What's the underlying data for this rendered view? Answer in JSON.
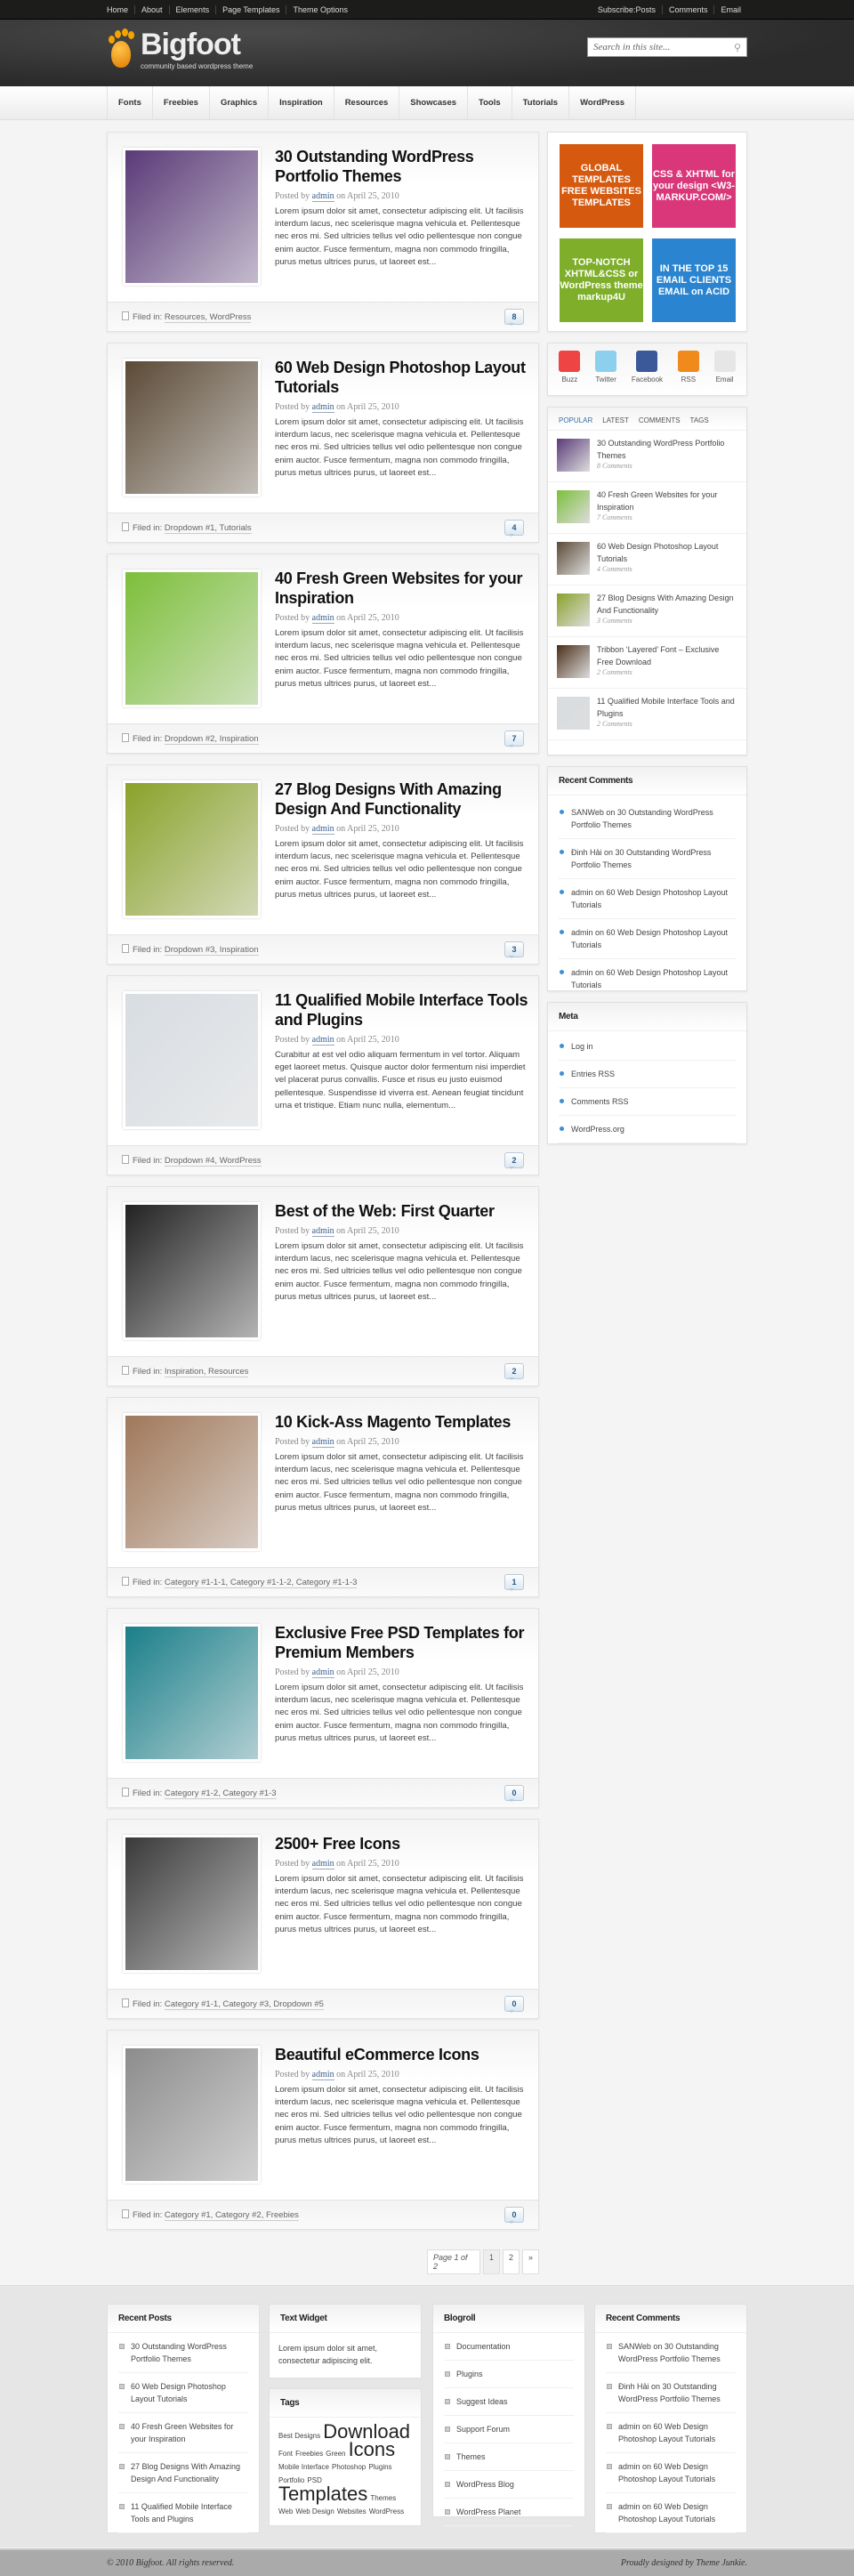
{
  "topbar": {
    "links": [
      "Home",
      "About",
      "Elements",
      "Page Templates",
      "Theme Options"
    ],
    "subscribe_label": "Subscribe:",
    "subscribe": [
      "Posts",
      "Comments",
      "Email"
    ]
  },
  "header": {
    "title": "Bigfoot",
    "tagline": "community based wordpress theme",
    "search_placeholder": "Search in this site..."
  },
  "nav": [
    "Fonts",
    "Freebies",
    "Graphics",
    "Inspiration",
    "Resources",
    "Showcases",
    "Tools",
    "Tutorials",
    "WordPress"
  ],
  "posted_by": "Posted by",
  "author": "admin",
  "date_prefix": "on",
  "filed_label": "Filed in:",
  "posts": [
    {
      "title": "30 Outstanding WordPress Portfolio Themes",
      "date": "April 25, 2010",
      "excerpt": "Lorem ipsum dolor sit amet, consectetur adipiscing elit. Ut facilisis interdum lacus, nec scelerisque magna vehicula et. Pellentesque nec eros mi. Sed ultricies tellus vel odio pellentesque non congue enim auctor. Fusce fermentum, magna non commodo fringilla, purus metus ultrices purus, ut laoreet est...",
      "categories": "Resources, WordPress",
      "comments": "8",
      "thumb": "#5a3a78"
    },
    {
      "title": "60 Web Design Photoshop Layout Tutorials",
      "date": "April 25, 2010",
      "excerpt": "Lorem ipsum dolor sit amet, consectetur adipiscing elit. Ut facilisis interdum lacus, nec scelerisque magna vehicula et. Pellentesque nec eros mi. Sed ultricies tellus vel odio pellentesque non congue enim auctor. Fusce fermentum, magna non commodo fringilla, purus metus ultrices purus, ut laoreet est...",
      "categories": "Dropdown #1, Tutorials",
      "comments": "4",
      "thumb": "#5b4a36"
    },
    {
      "title": "40 Fresh Green Websites for your Inspiration",
      "date": "April 25, 2010",
      "excerpt": "Lorem ipsum dolor sit amet, consectetur adipiscing elit. Ut facilisis interdum lacus, nec scelerisque magna vehicula et. Pellentesque nec eros mi. Sed ultricies tellus vel odio pellentesque non congue enim auctor. Fusce fermentum, magna non commodo fringilla, purus metus ultrices purus, ut laoreet est...",
      "categories": "Dropdown #2, Inspiration",
      "comments": "7",
      "thumb": "#7cbf3a"
    },
    {
      "title": "27 Blog Designs With Amazing Design And Functionality",
      "date": "April 25, 2010",
      "excerpt": "Lorem ipsum dolor sit amet, consectetur adipiscing elit. Ut facilisis interdum lacus, nec scelerisque magna vehicula et. Pellentesque nec eros mi. Sed ultricies tellus vel odio pellentesque non congue enim auctor. Fusce fermentum, magna non commodo fringilla, purus metus ultrices purus, ut laoreet est...",
      "categories": "Dropdown #3, Inspiration",
      "comments": "3",
      "thumb": "#8aa22a"
    },
    {
      "title": "11 Qualified Mobile Interface Tools and Plugins",
      "date": "April 25, 2010",
      "excerpt": "Curabitur at est vel odio aliquam fermentum in vel tortor. Aliquam eget laoreet metus. Quisque auctor dolor fermentum nisi imperdiet vel placerat purus convallis. Fusce et risus eu justo euismod pellentesque. Suspendisse id viverra est. Aenean feugiat tincidunt urna et tristique. Etiam nunc nulla, elementum...",
      "categories": "Dropdown #4, WordPress",
      "comments": "2",
      "thumb": "#d8dde2"
    },
    {
      "title": "Best of the Web: First Quarter",
      "date": "April 25, 2010",
      "excerpt": "Lorem ipsum dolor sit amet, consectetur adipiscing elit. Ut facilisis interdum lacus, nec scelerisque magna vehicula et. Pellentesque nec eros mi. Sed ultricies tellus vel odio pellentesque non congue enim auctor. Fusce fermentum, magna non commodo fringilla, purus metus ultrices purus, ut laoreet est...",
      "categories": "Inspiration, Resources",
      "comments": "2",
      "thumb": "#222"
    },
    {
      "title": "10 Kick-Ass Magento Templates",
      "date": "April 25, 2010",
      "excerpt": "Lorem ipsum dolor sit amet, consectetur adipiscing elit. Ut facilisis interdum lacus, nec scelerisque magna vehicula et. Pellentesque nec eros mi. Sed ultricies tellus vel odio pellentesque non congue enim auctor. Fusce fermentum, magna non commodo fringilla, purus metus ultrices purus, ut laoreet est...",
      "categories": "Category #1-1-1, Category #1-1-2, Category #1-1-3",
      "comments": "1",
      "thumb": "#a0785a"
    },
    {
      "title": "Exclusive Free PSD Templates for Premium Members",
      "date": "April 25, 2010",
      "excerpt": "Lorem ipsum dolor sit amet, consectetur adipiscing elit. Ut facilisis interdum lacus, nec scelerisque magna vehicula et. Pellentesque nec eros mi. Sed ultricies tellus vel odio pellentesque non congue enim auctor. Fusce fermentum, magna non commodo fringilla, purus metus ultrices purus, ut laoreet est...",
      "categories": "Category #1-2, Category #1-3",
      "comments": "0",
      "thumb": "#1a7f8a"
    },
    {
      "title": "2500+ Free Icons",
      "date": "April 25, 2010",
      "excerpt": "Lorem ipsum dolor sit amet, consectetur adipiscing elit. Ut facilisis interdum lacus, nec scelerisque magna vehicula et. Pellentesque nec eros mi. Sed ultricies tellus vel odio pellentesque non congue enim auctor. Fusce fermentum, magna non commodo fringilla, purus metus ultrices purus, ut laoreet est...",
      "categories": "Category #1-1, Category #3, Dropdown #5",
      "comments": "0",
      "thumb": "#3a3a3a"
    },
    {
      "title": "Beautiful eCommerce Icons",
      "date": "April 25, 2010",
      "excerpt": "Lorem ipsum dolor sit amet, consectetur adipiscing elit. Ut facilisis interdum lacus, nec scelerisque magna vehicula et. Pellentesque nec eros mi. Sed ultricies tellus vel odio pellentesque non congue enim auctor. Fusce fermentum, magna non commodo fringilla, purus metus ultrices purus, ut laoreet est...",
      "categories": "Category #1, Category #2, Freebies",
      "comments": "0",
      "thumb": "#8c8c8c"
    }
  ],
  "pagination": {
    "label": "Page 1 of 2",
    "pages": [
      "1",
      "2"
    ],
    "next": "»"
  },
  "ads": [
    {
      "text": "GLOBAL TEMPLATES FREE WEBSITES TEMPLATES",
      "color": "#d55a10"
    },
    {
      "text": "CSS & XHTML for your design <W3-MARKUP.COM/>",
      "color": "#d9377a"
    },
    {
      "text": "TOP-NOTCH XHTML&CSS or WordPress theme markup4U",
      "color": "#7eae2a"
    },
    {
      "text": "IN THE TOP 15 EMAIL CLIENTS EMAIL on ACID",
      "color": "#2a84d0"
    }
  ],
  "social": [
    {
      "label": "Buzz",
      "color": "#e44"
    },
    {
      "label": "Twitter",
      "color": "#8cd0ee"
    },
    {
      "label": "Facebook",
      "color": "#3b5998"
    },
    {
      "label": "RSS",
      "color": "#f08a1c"
    },
    {
      "label": "Email",
      "color": "#e6e6e6"
    }
  ],
  "tabs": [
    "POPULAR",
    "LATEST",
    "COMMENTS",
    "TAGS"
  ],
  "popular": [
    {
      "title": "30 Outstanding WordPress Portfolio Themes",
      "comments": "8 Comments",
      "thumb": "#5a3a78"
    },
    {
      "title": "40 Fresh Green Websites for your Inspiration",
      "comments": "7 Comments",
      "thumb": "#7cbf3a"
    },
    {
      "title": "60 Web Design Photoshop Layout Tutorials",
      "comments": "4 Comments",
      "thumb": "#5b4a36"
    },
    {
      "title": "27 Blog Designs With Amazing Design And Functionality",
      "comments": "3 Comments",
      "thumb": "#8aa22a"
    },
    {
      "title": "Tribbon ‘Layered’ Font – Exclusive Free Download",
      "comments": "2 Comments",
      "thumb": "#4a2e18"
    },
    {
      "title": "11 Qualified Mobile Interface Tools and Plugins",
      "comments": "2 Comments",
      "thumb": "#d8dde2"
    }
  ],
  "recent_comments": {
    "title": "Recent Comments",
    "items": [
      "SANWeb on 30 Outstanding WordPress Portfolio Themes",
      "Đinh Hải on 30 Outstanding WordPress Portfolio Themes",
      "admin on 60 Web Design Photoshop Layout Tutorials",
      "admin on 60 Web Design Photoshop Layout Tutorials",
      "admin on 60 Web Design Photoshop Layout Tutorials"
    ]
  },
  "meta": {
    "title": "Meta",
    "items": [
      "Log in",
      "Entries RSS",
      "Comments RSS",
      "WordPress.org"
    ]
  },
  "footer": {
    "recent_posts": {
      "title": "Recent Posts",
      "items": [
        "30 Outstanding WordPress Portfolio Themes",
        "60 Web Design Photoshop Layout Tutorials",
        "40 Fresh Green Websites for your Inspiration",
        "27 Blog Designs With Amazing Design And Functionality",
        "11 Qualified Mobile Interface Tools and Plugins"
      ]
    },
    "text_widget": {
      "title": "Text Widget",
      "text": "Lorem ipsum dolor sit amet, consectetur adipiscing elit."
    },
    "tags": {
      "title": "Tags",
      "items": [
        {
          "t": "Best Designs",
          "s": 1
        },
        {
          "t": "Download",
          "s": 3
        },
        {
          "t": "Font",
          "s": 1
        },
        {
          "t": "Freebies",
          "s": 1
        },
        {
          "t": "Green",
          "s": 1
        },
        {
          "t": "Icons",
          "s": 3
        },
        {
          "t": "Mobile Interface",
          "s": 1
        },
        {
          "t": "Photoshop",
          "s": 1
        },
        {
          "t": "Plugins",
          "s": 1
        },
        {
          "t": "Portfolio",
          "s": 1
        },
        {
          "t": "PSD",
          "s": 1
        },
        {
          "t": "Templates",
          "s": 3
        },
        {
          "t": "Themes",
          "s": 1
        },
        {
          "t": "Web",
          "s": 1
        },
        {
          "t": "Web Design",
          "s": 1
        },
        {
          "t": "Websites",
          "s": 1
        },
        {
          "t": "WordPress",
          "s": 1
        }
      ]
    },
    "blogroll": {
      "title": "Blogroll",
      "items": [
        "Documentation",
        "Plugins",
        "Suggest Ideas",
        "Support Forum",
        "Themes",
        "WordPress Blog",
        "WordPress Planet"
      ]
    },
    "recent_comments": {
      "title": "Recent Comments",
      "items": [
        "SANWeb on 30 Outstanding WordPress Portfolio Themes",
        "Đinh Hải on 30 Outstanding WordPress Portfolio Themes",
        "admin on 60 Web Design Photoshop Layout Tutorials",
        "admin on 60 Web Design Photoshop Layout Tutorials",
        "admin on 60 Web Design Photoshop Layout Tutorials"
      ]
    }
  },
  "copyright": "© 2010 Bigfoot. All rights reserved.",
  "credit": "Proudly designed by Theme Junkie."
}
